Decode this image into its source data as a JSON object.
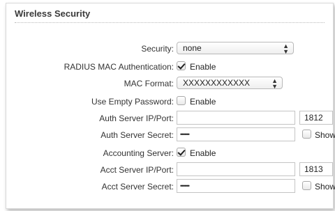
{
  "section": {
    "title": "Wireless Security"
  },
  "security": {
    "label": "Security:",
    "value": "none"
  },
  "radius_mac_auth": {
    "label": "RADIUS MAC Authentication:",
    "checked": true,
    "option": "Enable"
  },
  "mac_format": {
    "label": "MAC Format:",
    "value": "XXXXXXXXXXXX"
  },
  "use_empty_password": {
    "label": "Use Empty Password:",
    "checked": false,
    "option": "Enable"
  },
  "auth_server": {
    "label": "Auth Server IP/Port:",
    "ip": "",
    "port": "1812"
  },
  "auth_secret": {
    "label": "Auth Server Secret:",
    "value": "••••••",
    "show_label": "Show",
    "show_checked": false
  },
  "accounting_server": {
    "label": "Accounting Server:",
    "checked": true,
    "option": "Enable"
  },
  "acct_server": {
    "label": "Acct Server IP/Port:",
    "ip": "",
    "port": "1813"
  },
  "acct_secret": {
    "label": "Acct Server Secret:",
    "value": "••••••",
    "show_label": "Show",
    "show_checked": false
  }
}
